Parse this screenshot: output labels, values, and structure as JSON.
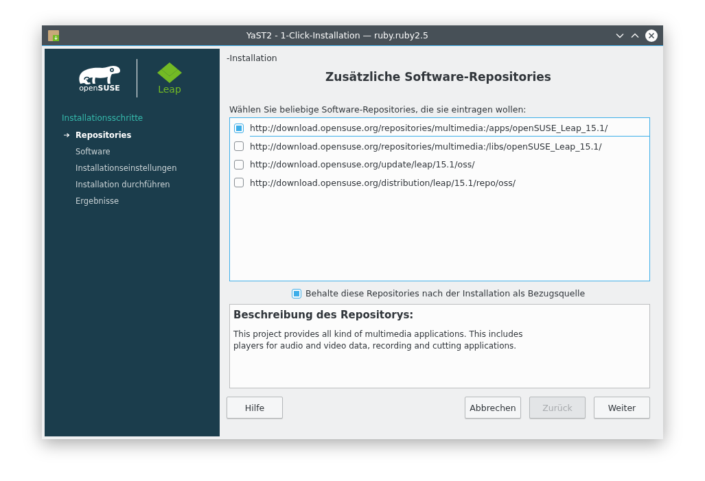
{
  "window": {
    "title": "YaST2 - 1-Click-Installation — ruby.ruby2.5"
  },
  "logo": {
    "brand": "open**SUSE**",
    "product": "Leap"
  },
  "sidebar": {
    "heading": "Installationsschritte",
    "steps": [
      {
        "label": "Repositories",
        "current": true
      },
      {
        "label": "Software",
        "current": false
      },
      {
        "label": "Installationseinstellungen",
        "current": false
      },
      {
        "label": "Installation durchführen",
        "current": false
      },
      {
        "label": "Ergebnisse",
        "current": false
      }
    ]
  },
  "breadcrumb": "-Installation",
  "heading": "Zusätzliche Software-Repositories",
  "list_label": "Wählen Sie beliebige Software-Repositories, die sie eintragen wollen:",
  "repositories": [
    {
      "url": "http://download.opensuse.org/repositories/multimedia:/apps/openSUSE_Leap_15.1/",
      "checked": true,
      "selected": true
    },
    {
      "url": "http://download.opensuse.org/repositories/multimedia:/libs/openSUSE_Leap_15.1/",
      "checked": false,
      "selected": false
    },
    {
      "url": "http://download.opensuse.org/update/leap/15.1/oss/",
      "checked": false,
      "selected": false
    },
    {
      "url": "http://download.opensuse.org/distribution/leap/15.1/repo/oss/",
      "checked": false,
      "selected": false
    }
  ],
  "keep_option": {
    "label": "Behalte diese Repositories nach der Installation als Bezugsquelle",
    "checked": true
  },
  "description": {
    "title": "Beschreibung des Repositorys:",
    "lines": [
      "This project provides all kind of multimedia applications. This includes",
      "players for audio and video data, recording and cutting applications."
    ]
  },
  "buttons_left": [
    {
      "label": "Hilfe",
      "disabled": false
    }
  ],
  "buttons_right": [
    {
      "label": "Abbrechen",
      "disabled": false
    },
    {
      "label": "Zurück",
      "disabled": true
    },
    {
      "label": "Weiter",
      "disabled": false
    }
  ]
}
